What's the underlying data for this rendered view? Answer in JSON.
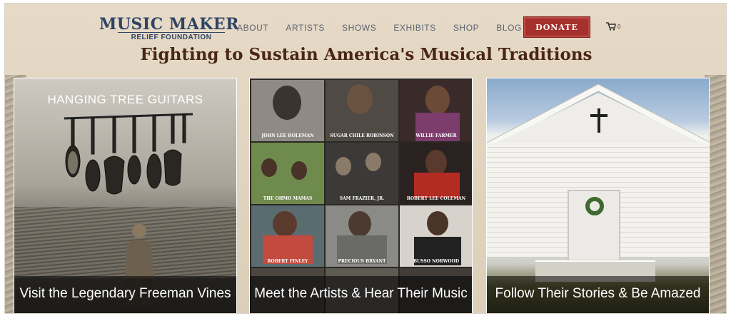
{
  "logo": {
    "main": "MUSIC MAKER",
    "sub": "RELIEF FOUNDATION"
  },
  "nav": {
    "items": [
      "ABOUT",
      "ARTISTS",
      "SHOWS",
      "EXHIBITS",
      "SHOP",
      "BLOG"
    ],
    "donate": "DONATE",
    "cart_count": "0"
  },
  "headline": "Fighting to Sustain America's Musical Traditions",
  "panels": {
    "left": {
      "title": "HANGING TREE GUITARS",
      "caption": "Visit the Legendary Freeman Vines"
    },
    "middle": {
      "caption": "Meet the Artists & Hear Their Music",
      "artists": [
        "JOHN LEE HOLEMAN",
        "SUGAR CHILE ROBINSON",
        "WILLIE FARMER",
        "THE OHMO MAMAS",
        "SAM FRAZIER, JR.",
        "ROBERT LEE COLEMAN",
        "ROBERT FINLEY",
        "PRECIOUS BRYANT",
        "BUSSO NORWOOD"
      ]
    },
    "right": {
      "caption": "Follow Their Stories & Be Amazed"
    }
  },
  "colors": {
    "accent": "#a5302c",
    "brand": "#2f4464",
    "headline": "#4a2614"
  }
}
